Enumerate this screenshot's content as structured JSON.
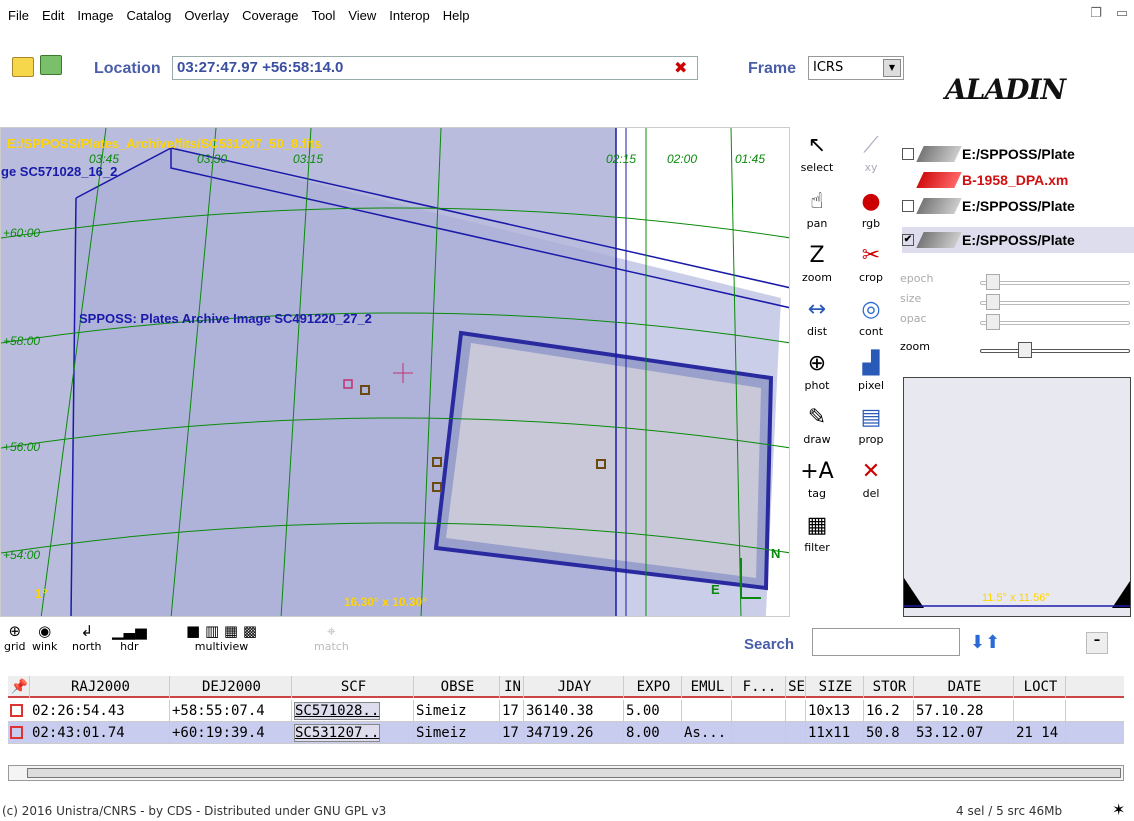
{
  "menu": [
    "File",
    "Edit",
    "Image",
    "Catalog",
    "Overlay",
    "Coverage",
    "Tool",
    "View",
    "Interop",
    "Help"
  ],
  "toolbar": {
    "location_label": "Location",
    "location_value": "03:27:47.97 +56:58:14.0",
    "frame_label": "Frame",
    "frame_value": "ICRS"
  },
  "logo": "ALADIN",
  "view": {
    "image_path": "E:/SPPOSS/Plates_Archive/fits/SC531207_50_8.fits",
    "label_left": "ge SC571028_16_2",
    "label_left_prefix": "SC571",
    "plates_label": "SPPOSS: Plates Archive Image SC491220_27_2",
    "fov": "16.30° x 10.30°",
    "scale": "1°",
    "north": "N",
    "east": "E",
    "ra_ticks": [
      "03:45",
      "03:30",
      "03:15",
      "02:15",
      "02:00",
      "01:45"
    ],
    "dec_ticks": [
      "+60:00",
      "+58:00",
      "+56:00",
      "+54:00"
    ]
  },
  "tools": [
    {
      "name": "select",
      "label": "select"
    },
    {
      "name": "xy",
      "label": "xy"
    },
    {
      "name": "pan",
      "label": "pan"
    },
    {
      "name": "rgb",
      "label": "rgb"
    },
    {
      "name": "zoom",
      "label": "zoom"
    },
    {
      "name": "crop",
      "label": "crop"
    },
    {
      "name": "dist",
      "label": "dist"
    },
    {
      "name": "cont",
      "label": "cont"
    },
    {
      "name": "phot",
      "label": "phot"
    },
    {
      "name": "pixel",
      "label": "pixel"
    },
    {
      "name": "draw",
      "label": "draw"
    },
    {
      "name": "prop",
      "label": "prop"
    },
    {
      "name": "tag",
      "label": "tag"
    },
    {
      "name": "del",
      "label": "del"
    },
    {
      "name": "filter",
      "label": "filter"
    }
  ],
  "layers": [
    {
      "label": "E:/SPPOSS/Plate",
      "checked": false
    },
    {
      "label": "B-1958_DPA.xm",
      "checked": false
    },
    {
      "label": "E:/SPPOSS/Plate",
      "checked": false
    },
    {
      "label": "E:/SPPOSS/Plate",
      "checked": true
    }
  ],
  "sliders": [
    "epoch",
    "size",
    "opac",
    "zoom"
  ],
  "preview": {
    "fov": "11.5° x 11.56°"
  },
  "viewtools": [
    "grid",
    "wink",
    "north",
    "hdr",
    "multiview",
    "match"
  ],
  "search": {
    "label": "Search",
    "value": ""
  },
  "table": {
    "headers": [
      "RAJ2000",
      "DEJ2000",
      "SCF",
      "OBSE",
      "IN",
      "JDAY",
      "EXPO",
      "EMUL",
      "F...",
      "SE",
      "SIZE",
      "STOR",
      "DATE",
      "LOCT"
    ],
    "rows": [
      [
        "02:26:54.43",
        "+58:55:07.4",
        "SC571028..",
        "Simeiz",
        "17",
        "36140.38",
        "5.00",
        "",
        "",
        "",
        "10x13",
        "16.2",
        "57.10.28",
        ""
      ],
      [
        "02:43:01.74",
        "+60:19:39.4",
        "SC531207..",
        "Simeiz",
        "17",
        "34719.26",
        "8.00",
        "As...",
        "",
        "",
        "11x11",
        "50.8",
        "53.12.07",
        "21 14"
      ]
    ]
  },
  "status": {
    "left": "(c) 2016 Unistra/CNRS - by CDS - Distributed under GNU GPL v3",
    "right": "4 sel / 5 src   46Mb"
  },
  "colors": {
    "accent": "#4a5ea8",
    "grid": "#0a8a0a",
    "overlay": "#1a1aaa",
    "path": "#ffd400"
  }
}
